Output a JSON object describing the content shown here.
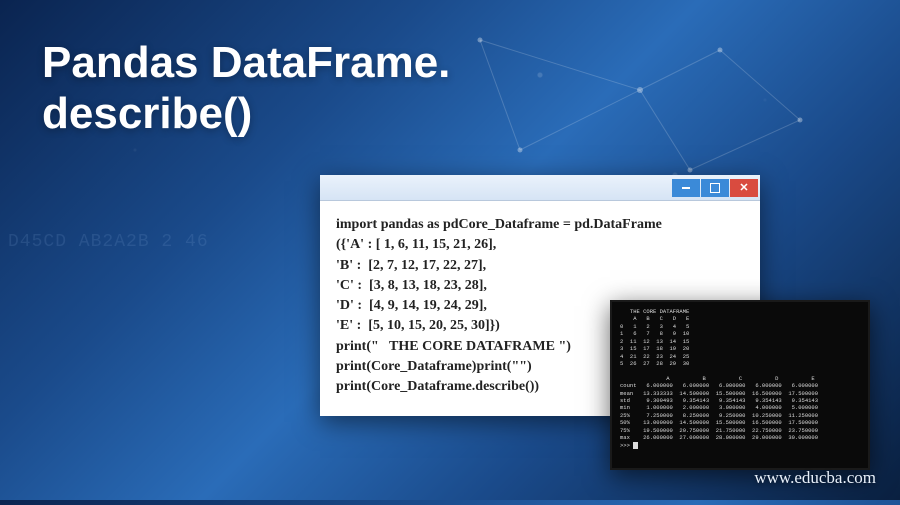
{
  "title_line1": "Pandas DataFrame.",
  "title_line2": "describe()",
  "bg_hex": "D45CD\nAB2A2B\n  2 46",
  "code": {
    "l1": "import pandas as pdCore_Dataframe = pd.DataFrame",
    "l2": "({'A' : [ 1, 6, 11, 15, 21, 26],",
    "l3": "'B' :  [2, 7, 12, 17, 22, 27],",
    "l4": "'C' :  [3, 8, 13, 18, 23, 28],",
    "l5": "'D' :  [4, 9, 14, 19, 24, 29],",
    "l6": "'E' :  [5, 10, 15, 20, 25, 30]})",
    "l7": "print(\"   THE CORE DATAFRAME \")",
    "l8": "print(Core_Dataframe)print(\"\")",
    "l9": "print(Core_Dataframe.describe())"
  },
  "terminal": {
    "header": "   THE CORE DATAFRAME",
    "cols": "    A   B   C   D   E",
    "r0": "0   1   2   3   4   5",
    "r1": "1   6   7   8   9  10",
    "r2": "2  11  12  13  14  15",
    "r3": "3  15  17  18  19  20",
    "r4": "4  21  22  23  24  25",
    "r5": "5  26  27  28  29  30",
    "blank": "",
    "dcols": "              A          B          C          D          E",
    "count": "count   6.000000   6.000000   6.000000   6.000000   6.000000",
    "mean": "mean   13.333333  14.500000  15.500000  16.500000  17.500000",
    "std": "std     9.309493   9.354143   9.354143   9.354143   9.354143",
    "min": "min     1.000000   2.000000   3.000000   4.000000   5.000000",
    "p25": "25%     7.250000   8.250000   9.250000  10.250000  11.250000",
    "p50": "50%    13.000000  14.500000  15.500000  16.500000  17.500000",
    "p75": "75%    19.500000  20.750000  21.750000  22.750000  23.750000",
    "max": "max    26.000000  27.000000  28.000000  29.000000  30.000000",
    "prompt": ">>> "
  },
  "watermark": "www.educba.com"
}
